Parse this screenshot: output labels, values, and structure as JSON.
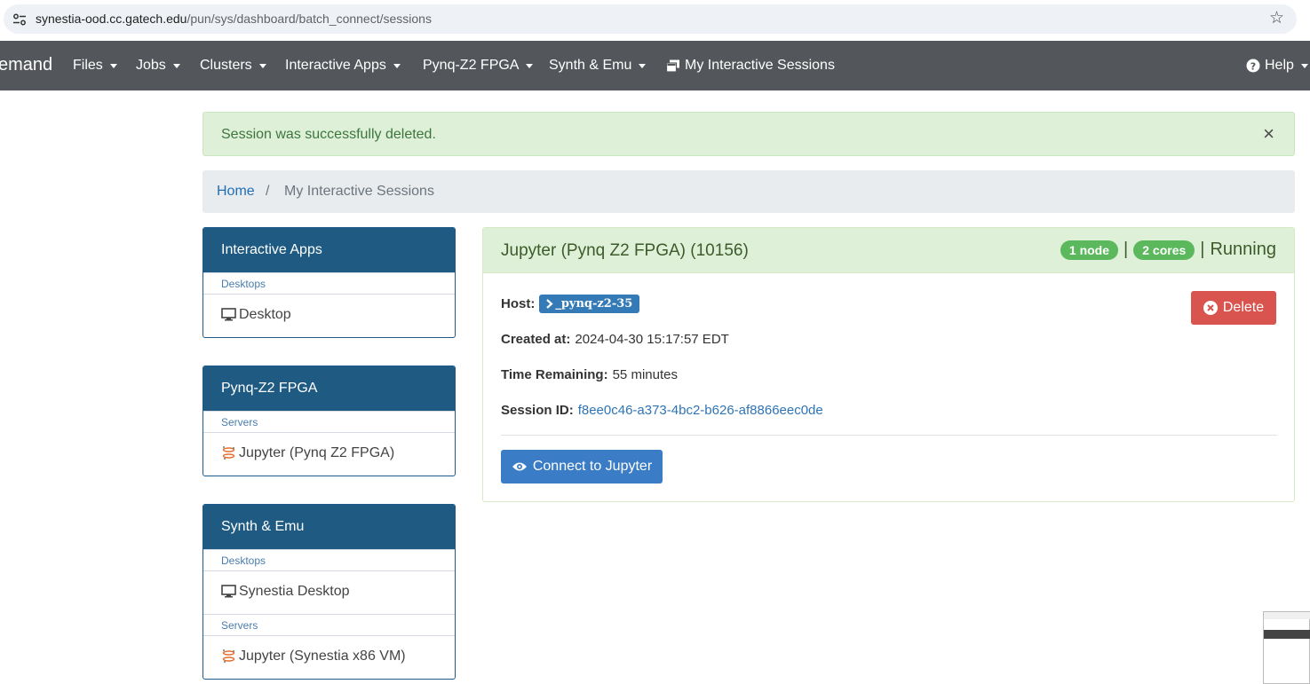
{
  "browser": {
    "url_host": "synestia-ood.cc.gatech.edu",
    "url_path": "/pun/sys/dashboard/batch_connect/sessions"
  },
  "navbar": {
    "brand": "emand",
    "items": [
      {
        "label": "Files",
        "dropdown": true
      },
      {
        "label": "Jobs",
        "dropdown": true
      },
      {
        "label": "Clusters",
        "dropdown": true
      },
      {
        "label": "Interactive Apps",
        "dropdown": true
      },
      {
        "label": "Pynq-Z2 FPGA",
        "dropdown": true
      },
      {
        "label": "Synth & Emu",
        "dropdown": true
      },
      {
        "label": "My Interactive Sessions",
        "dropdown": false
      }
    ],
    "help": "Help"
  },
  "alert": {
    "message": "Session was successfully deleted.",
    "close": "×"
  },
  "breadcrumb": {
    "home": "Home",
    "separator": "/",
    "current": "My Interactive Sessions"
  },
  "sidebar": {
    "panels": [
      {
        "title": "Interactive Apps",
        "groups": [
          {
            "label": "Desktops",
            "items": [
              {
                "label": "Desktop",
                "icon": "monitor-icon"
              }
            ]
          }
        ]
      },
      {
        "title": "Pynq-Z2 FPGA",
        "groups": [
          {
            "label": "Servers",
            "items": [
              {
                "label": "Jupyter (Pynq Z2 FPGA)",
                "icon": "jupyter-icon"
              }
            ]
          }
        ]
      },
      {
        "title": "Synth & Emu",
        "groups": [
          {
            "label": "Desktops",
            "items": [
              {
                "label": "Synestia Desktop",
                "icon": "monitor-icon"
              }
            ]
          },
          {
            "label": "Servers",
            "items": [
              {
                "label": "Jupyter (Synestia x86 VM)",
                "icon": "jupyter-icon"
              }
            ]
          }
        ]
      }
    ]
  },
  "session": {
    "title": "Jupyter (Pynq Z2 FPGA) (10156)",
    "nodes": "1 node",
    "cores": "2 cores",
    "separator": "|",
    "status": "Running",
    "host_label": "Host:",
    "host": "_pynq-z2-35",
    "created_label": "Created at:",
    "created": "2024-04-30 15:17:57 EDT",
    "time_label": "Time Remaining:",
    "time_remaining": "55 minutes",
    "sid_label": "Session ID:",
    "session_id": "f8ee0c46-a373-4bc2-b626-af8866eec0de",
    "delete_label": "Delete",
    "connect_label": "Connect to Jupyter"
  },
  "colors": {
    "navbar": "#53565a",
    "panel_header": "#1e5a82",
    "alert_bg": "#dff0d8",
    "badge_green": "#5cb85c",
    "delete_red": "#d9534f",
    "connect_blue": "#3a7cc5"
  }
}
